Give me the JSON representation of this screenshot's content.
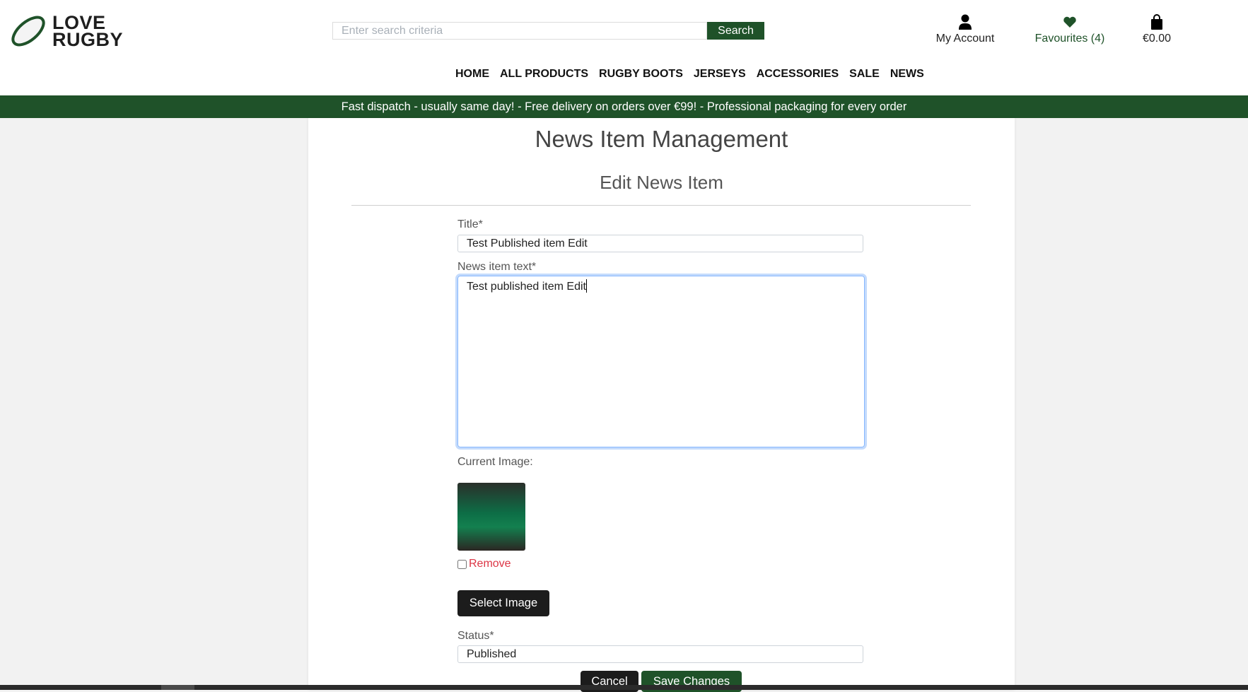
{
  "header": {
    "logo_text": [
      "LOVE",
      "RUGBY"
    ],
    "search_placeholder": "Enter search criteria",
    "search_label": "Search",
    "account_label": "My Account",
    "favourites_label": "Favourites (4)",
    "cart_total": "€0.00"
  },
  "nav": [
    "HOME",
    "ALL PRODUCTS",
    "RUGBY BOOTS",
    "JERSEYS",
    "ACCESSORIES",
    "SALE",
    "NEWS"
  ],
  "banner": "Fast dispatch - usually same day! - Free delivery on orders over €99! - Professional packaging for every order",
  "page": {
    "title": "News Item Management",
    "subtitle": "Edit News Item"
  },
  "form": {
    "title_label": "Title*",
    "title_value": "Test Published item Edit",
    "text_label": "News item text*",
    "text_value": "Test published item Edit",
    "image_label": "Current Image:",
    "remove_label": "Remove",
    "select_image": "Select Image",
    "status_label": "Status*",
    "status_value": "Published",
    "cancel": "Cancel",
    "save": "Save Changes"
  },
  "colors": {
    "brand": "#1f5229",
    "danger": "#dc3545",
    "dark_button": "#1c1c1c"
  }
}
